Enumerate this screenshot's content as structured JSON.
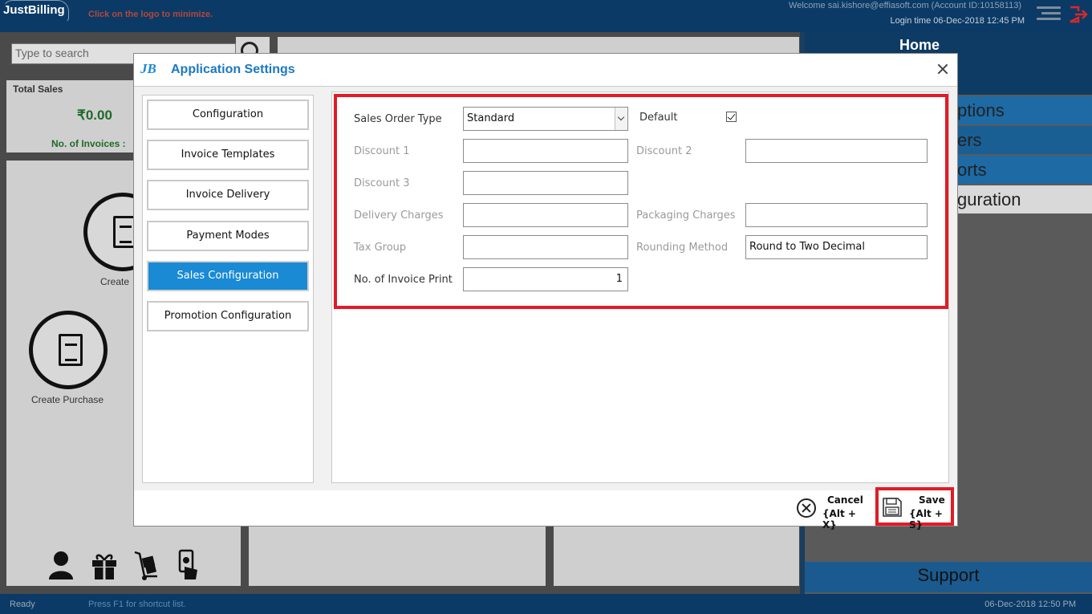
{
  "app": {
    "logo": "JustBilling",
    "minimize_hint": "Click on the logo to minimize.",
    "welcome": "Welcome sai.kishore@effiasoft.com (Account ID:10158113)",
    "login_time": "Login time  06-Dec-2018 12:45 PM"
  },
  "background": {
    "search_placeholder": "Type to search",
    "total_sales_label": "Total Sales",
    "total_sales_value": "₹0.00",
    "invoices_label": "No. of Invoices :",
    "tiles": [
      {
        "label": "Create"
      },
      {
        "label": "Create Purchase"
      }
    ],
    "home_title": "Home",
    "menu_items": [
      {
        "label": "ptions"
      },
      {
        "label": "ers"
      },
      {
        "label": "orts"
      },
      {
        "label": "guration"
      }
    ],
    "support": "Support"
  },
  "status": {
    "ready": "Ready",
    "hint": "Press F1 for shortcut list.",
    "time": "06-Dec-2018 12:50 PM"
  },
  "modal": {
    "logo": "JB",
    "title": "Application Settings",
    "nav": [
      {
        "label": "Configuration",
        "active": false
      },
      {
        "label": "Invoice Templates",
        "active": false
      },
      {
        "label": "Invoice Delivery",
        "active": false
      },
      {
        "label": "Payment Modes",
        "active": false
      },
      {
        "label": "Sales Configuration",
        "active": true
      },
      {
        "label": "Promotion Configuration",
        "active": false
      }
    ],
    "form": {
      "sales_order_type_label": "Sales Order Type",
      "sales_order_type_value": "Standard",
      "default_label": "Default",
      "default_checked": true,
      "discount1_label": "Discount 1",
      "discount1_value": "",
      "discount2_label": "Discount 2",
      "discount2_value": "",
      "discount3_label": "Discount 3",
      "discount3_value": "",
      "delivery_charges_label": "Delivery Charges",
      "delivery_charges_value": "",
      "packaging_charges_label": "Packaging Charges",
      "packaging_charges_value": "",
      "tax_group_label": "Tax Group",
      "tax_group_value": "",
      "rounding_method_label": "Rounding Method",
      "rounding_method_value": "Round to Two Decimal",
      "invoice_print_label": "No. of Invoice Print",
      "invoice_print_value": "1"
    },
    "footer": {
      "cancel_label": "Cancel",
      "cancel_shortcut": "{Alt + X}",
      "save_label": "Save",
      "save_shortcut": "{Alt + S}"
    }
  },
  "colors": {
    "accent": "#1a8ad4",
    "highlight": "#e11b26",
    "topbar": "#0b3a66"
  }
}
